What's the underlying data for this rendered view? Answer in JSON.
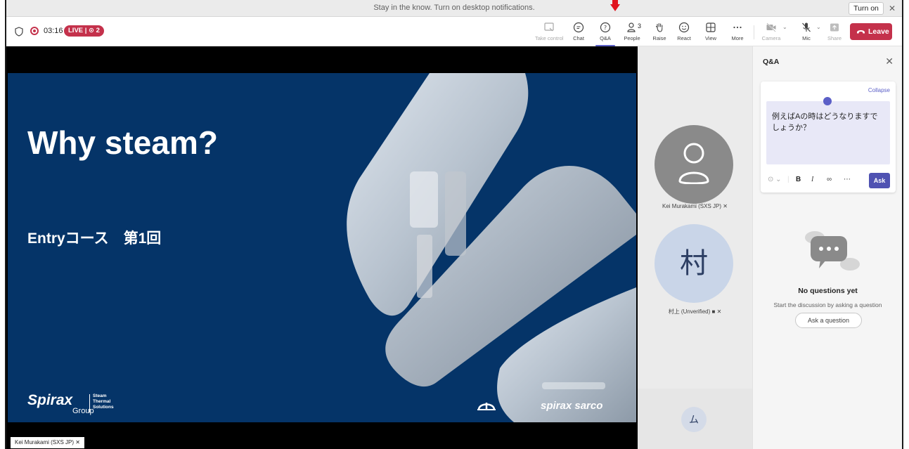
{
  "notification": {
    "text": "Stay in the know. Turn on desktop notifications.",
    "button": "Turn on",
    "close": "✕"
  },
  "meeting": {
    "timer": "03:16",
    "live_badge": "LIVE | ⊙ 2",
    "toolbar": {
      "take_control": "Take control",
      "chat": "Chat",
      "qa": "Q&A",
      "people": "People",
      "people_count": "3",
      "raise": "Raise",
      "react": "React",
      "view": "View",
      "more": "More",
      "camera": "Camera",
      "mic": "Mic",
      "share": "Share",
      "leave": "Leave"
    }
  },
  "slide": {
    "title": "Why steam?",
    "subtitle": "Entryコース　第1回",
    "brand_left": "Spirax",
    "brand_left_group": "Group",
    "brand_left_sub": [
      "Steam",
      "Thermal",
      "Solutions"
    ],
    "brand_right": "spirax sarco"
  },
  "stage": {
    "presenter_tag": "Kei Murakami (SXS JP)"
  },
  "participants": [
    {
      "name": "Kei Murakami (SXS JP)",
      "avatar": ""
    },
    {
      "name": "村上 (Unverified)",
      "avatar": "村"
    }
  ],
  "self": {
    "avatar": "ム"
  },
  "qa_panel": {
    "title": "Q&A",
    "collapse": "Collapse",
    "draft": "例えばAの時はどうなりますでしょうか？",
    "ask": "Ask",
    "empty_title": "No questions yet",
    "empty_sub": "Start the discussion by asking a question",
    "ask_question": "Ask a question"
  },
  "colors": {
    "accent": "#5b5fc7",
    "leave": "#c4314b",
    "slide_bg": "#053468"
  }
}
